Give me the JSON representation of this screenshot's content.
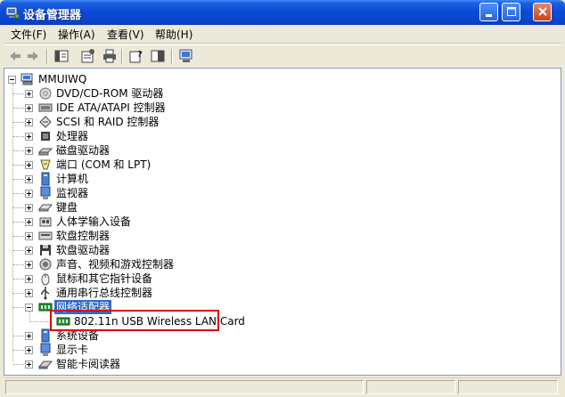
{
  "window": {
    "title": "设备管理器",
    "controls": {
      "minimize": "minimize-icon",
      "maximize": "maximize-icon",
      "close": "close-icon"
    }
  },
  "menu": [
    {
      "label": "文件(F)"
    },
    {
      "label": "操作(A)"
    },
    {
      "label": "查看(V)"
    },
    {
      "label": "帮助(H)"
    }
  ],
  "toolbar": {
    "icons": [
      "back-icon",
      "forward-icon",
      "tree-view-icon",
      "properties-icon",
      "print-icon",
      "help-icon",
      "console-tree-icon",
      "scan-hardware-icon"
    ]
  },
  "tree": {
    "root": "MMUIWQ",
    "items": [
      {
        "label": "DVD/CD-ROM 驱动器",
        "icon": "cdrom-icon"
      },
      {
        "label": "IDE ATA/ATAPI 控制器",
        "icon": "ide-controller-icon"
      },
      {
        "label": "SCSI 和 RAID 控制器",
        "icon": "scsi-icon"
      },
      {
        "label": "处理器",
        "icon": "processor-icon"
      },
      {
        "label": "磁盘驱动器",
        "icon": "disk-drive-icon"
      },
      {
        "label": "端口 (COM 和 LPT)",
        "icon": "port-icon"
      },
      {
        "label": "计算机",
        "icon": "computer-icon"
      },
      {
        "label": "监视器",
        "icon": "monitor-icon"
      },
      {
        "label": "键盘",
        "icon": "keyboard-icon"
      },
      {
        "label": "人体学输入设备",
        "icon": "hid-icon"
      },
      {
        "label": "软盘控制器",
        "icon": "floppy-controller-icon"
      },
      {
        "label": "软盘驱动器",
        "icon": "floppy-drive-icon"
      },
      {
        "label": "声音、视频和游戏控制器",
        "icon": "sound-icon"
      },
      {
        "label": "鼠标和其它指针设备",
        "icon": "mouse-icon"
      },
      {
        "label": "通用串行总线控制器",
        "icon": "usb-icon"
      },
      {
        "label": "网络适配器",
        "icon": "network-adapter-icon",
        "expanded": true,
        "selected": true,
        "children": [
          {
            "label": "802.11n USB Wireless LAN Card",
            "icon": "network-card-icon"
          }
        ]
      },
      {
        "label": "系统设备",
        "icon": "system-device-icon"
      },
      {
        "label": "显示卡",
        "icon": "display-adapter-icon"
      },
      {
        "label": "智能卡阅读器",
        "icon": "smart-card-reader-icon"
      }
    ]
  }
}
